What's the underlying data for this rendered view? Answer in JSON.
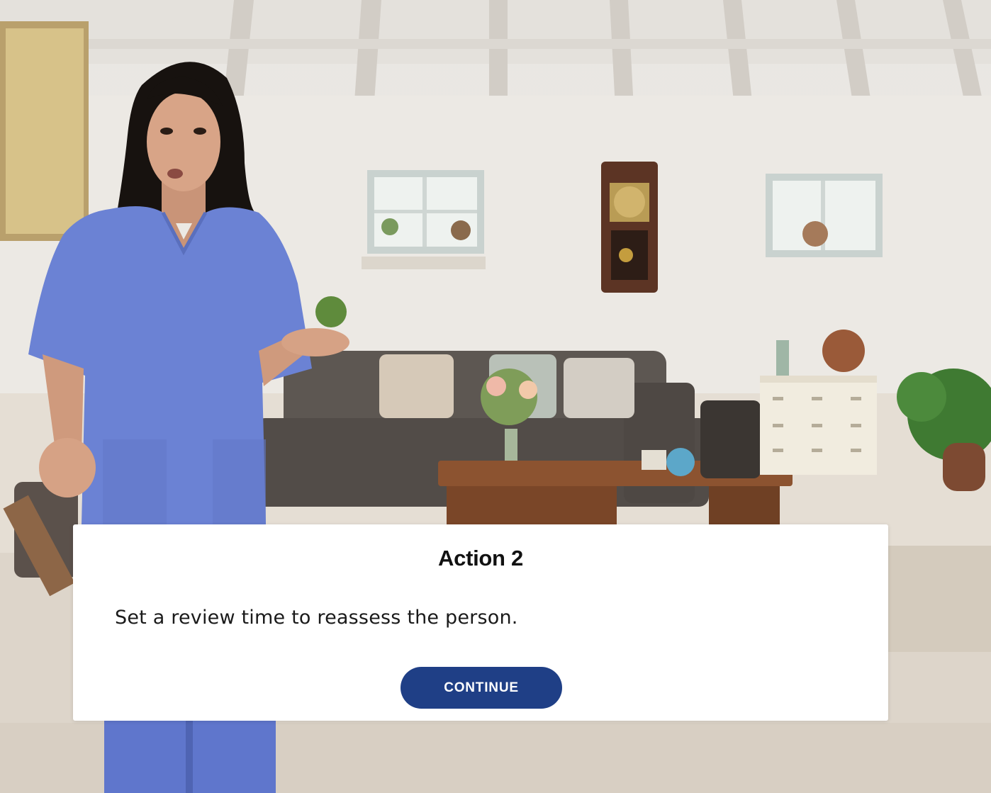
{
  "dialog": {
    "title": "Action 2",
    "body": "Set a review time to reassess the person.",
    "continue_label": "CONTINUE"
  },
  "colors": {
    "button_background": "#1f3f86",
    "button_text": "#ffffff",
    "dialog_background": "#ffffff",
    "scrubs": "#6b82d4"
  }
}
